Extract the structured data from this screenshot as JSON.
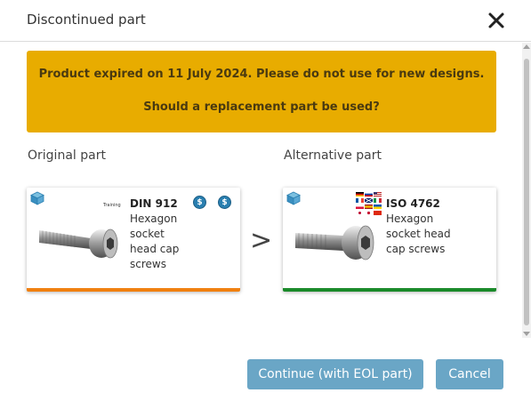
{
  "dialog": {
    "title": "Discontinued part",
    "close_icon": "close-icon"
  },
  "banner": {
    "line1": "Product expired on 11 July 2024. Please do not use for new designs.",
    "line2": "Should a replacement part be used?",
    "color": "#e8ac00"
  },
  "labels": {
    "original": "Original part",
    "alternative": "Alternative part"
  },
  "original_card": {
    "code": "DIN 912",
    "description": "Hexagon socket head cap screws",
    "tag": "Training",
    "icons": [
      "cube-icon",
      "dollar-icon",
      "dollar-icon"
    ],
    "status_color": "#f08010"
  },
  "alternative_card": {
    "code": "ISO 4762",
    "description": "Hexagon socket head cap screws",
    "icons": [
      "cube-icon",
      "flags-icon"
    ],
    "status_color": "#1a8a2a"
  },
  "arrow": ">",
  "buttons": {
    "continue": "Continue (with EOL part)",
    "cancel": "Cancel"
  }
}
